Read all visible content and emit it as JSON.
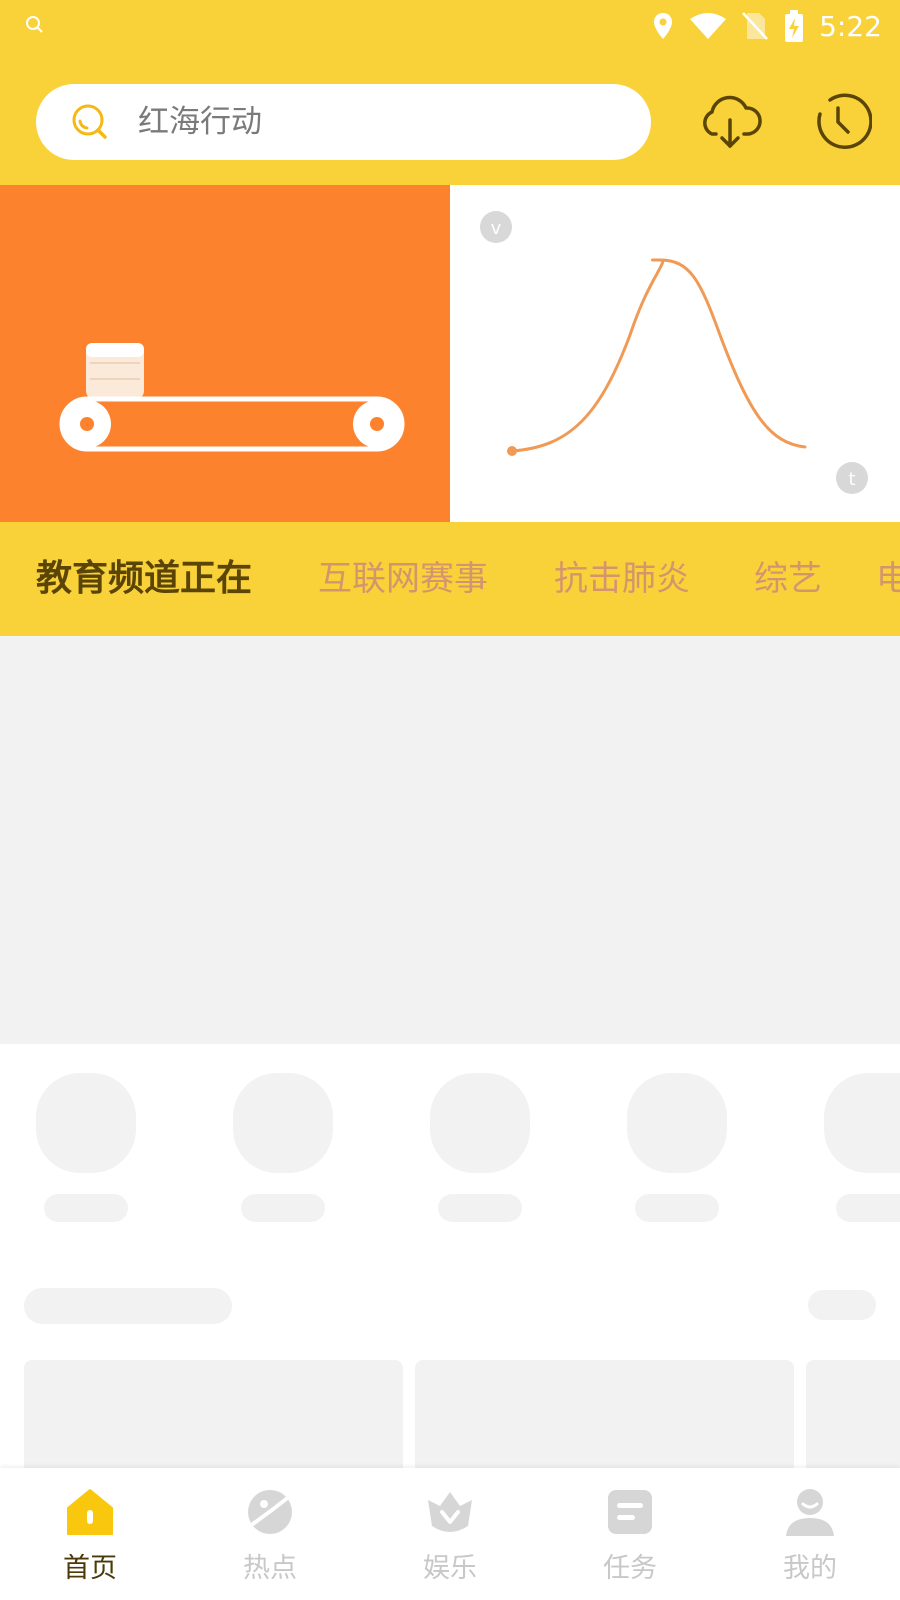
{
  "status_bar": {
    "time": "5:22",
    "icons": [
      "search-icon",
      "location-icon",
      "wifi-icon",
      "no-sim-icon",
      "battery-charging-icon"
    ]
  },
  "header": {
    "search": {
      "value": "红海行动"
    },
    "download_icon": "cloud-download-icon",
    "history_icon": "history-clock-icon"
  },
  "banner": {
    "left_graphic": "conveyor-belt",
    "right_graphic": "bell-curve",
    "right_axis_labels": {
      "y": "v",
      "x": "t"
    }
  },
  "channel_tabs": [
    {
      "label": "教育频道正在",
      "active": true
    },
    {
      "label": "互联网赛事",
      "active": false
    },
    {
      "label": "抗击肺炎",
      "active": false
    },
    {
      "label": "综艺",
      "active": false
    },
    {
      "label": "电",
      "active": false
    }
  ],
  "bottom_nav": [
    {
      "label": "首页",
      "icon": "home-icon",
      "active": true
    },
    {
      "label": "热点",
      "icon": "planet-icon",
      "active": false
    },
    {
      "label": "娱乐",
      "icon": "crown-icon",
      "active": false
    },
    {
      "label": "任务",
      "icon": "task-icon",
      "active": false
    },
    {
      "label": "我的",
      "icon": "profile-icon",
      "active": false
    }
  ],
  "colors": {
    "header_yellow": "#F9D23A",
    "banner_orange": "#FD822E",
    "tab_active": "#5b4506",
    "tab_inactive": "#d4956d",
    "skeleton": "#F2F2F2",
    "nav_active_icon": "#F9C80E",
    "nav_inactive": "#c8c8c8"
  }
}
